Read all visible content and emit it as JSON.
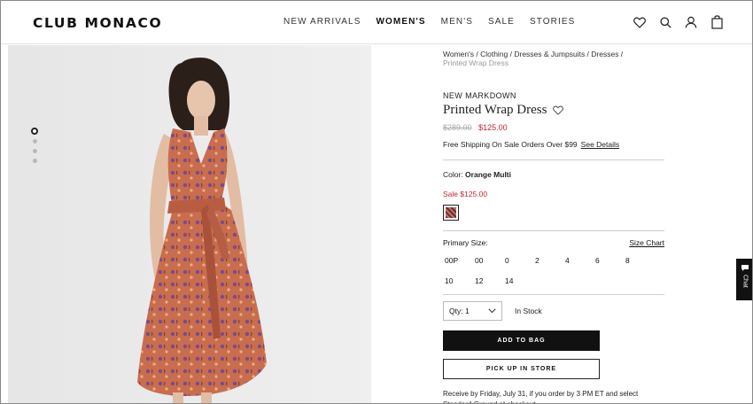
{
  "header": {
    "logo": "CLUB MONACO",
    "nav": [
      "NEW ARRIVALS",
      "WOMEN'S",
      "MEN'S",
      "SALE",
      "STORIES"
    ],
    "active_nav": "WOMEN'S",
    "icons": [
      "heart-icon",
      "search-icon",
      "account-icon",
      "bag-icon"
    ]
  },
  "gallery": {
    "dot_count": 4,
    "active_index": 0
  },
  "product": {
    "breadcrumb": "Women's / Clothing / Dresses & Jumpsuits / Dresses /",
    "breadcrumb_current": "Printed Wrap Dress",
    "tag": "NEW MARKDOWN",
    "title": "Printed Wrap Dress",
    "old_price": "$289.00",
    "new_price": "$125.00",
    "shipping_text": "Free Shipping On Sale Orders Over $99",
    "shipping_link": "See Details",
    "color_label": "Color: ",
    "color_value": "Orange Multi",
    "sale_price": "Sale $125.00",
    "size_label": "Primary Size:",
    "size_chart": "Size Chart",
    "sizes": [
      "00P",
      "00",
      "0",
      "2",
      "4",
      "6",
      "8",
      "10",
      "12",
      "14"
    ],
    "qty_label": "Qty: 1",
    "stock": "In Stock",
    "add_to_bag": "ADD TO BAG",
    "pickup": "PICK UP IN STORE",
    "receive_text": "Receive by Friday, July 31, if you order by 3 PM ET and select Standard Ground at checkout"
  },
  "chat": {
    "label": "Chat"
  },
  "colors": {
    "accent_sale": "#c4262e",
    "button_black": "#111111",
    "image_background": "#e9e9e9"
  }
}
